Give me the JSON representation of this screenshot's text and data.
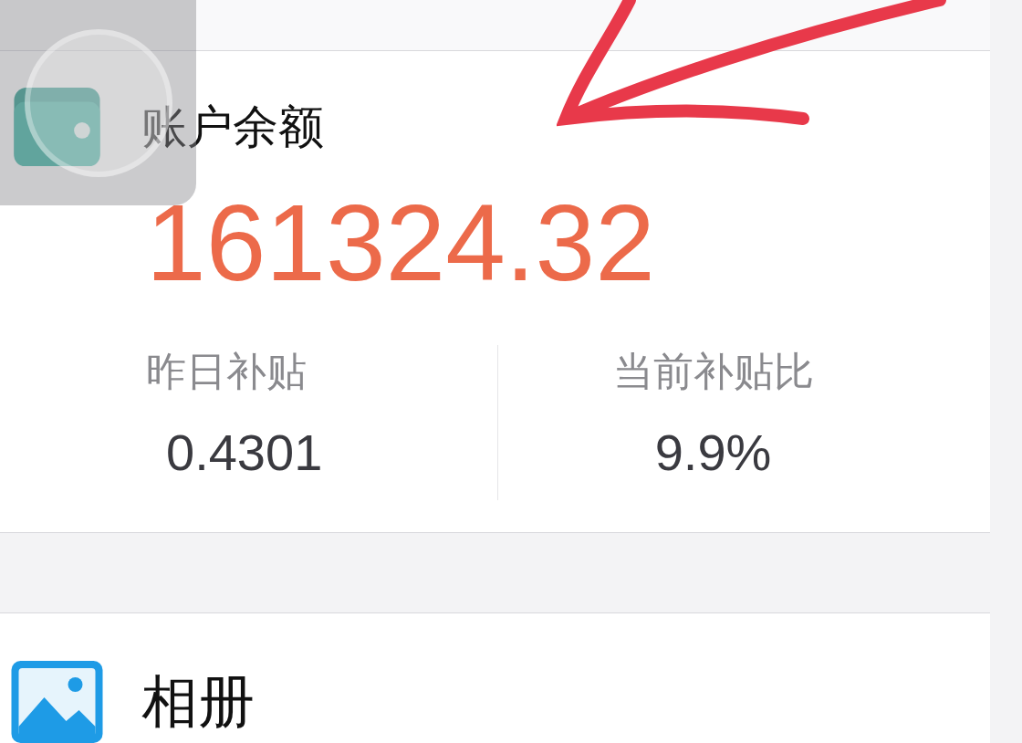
{
  "balance_card": {
    "title": "账户余额",
    "amount": "161324.32",
    "stats": [
      {
        "label": "昨日补贴",
        "value": "0.4301"
      },
      {
        "label": "当前补贴比",
        "value": "9.9%"
      }
    ]
  },
  "list_items": [
    {
      "title": "相册"
    }
  ]
}
